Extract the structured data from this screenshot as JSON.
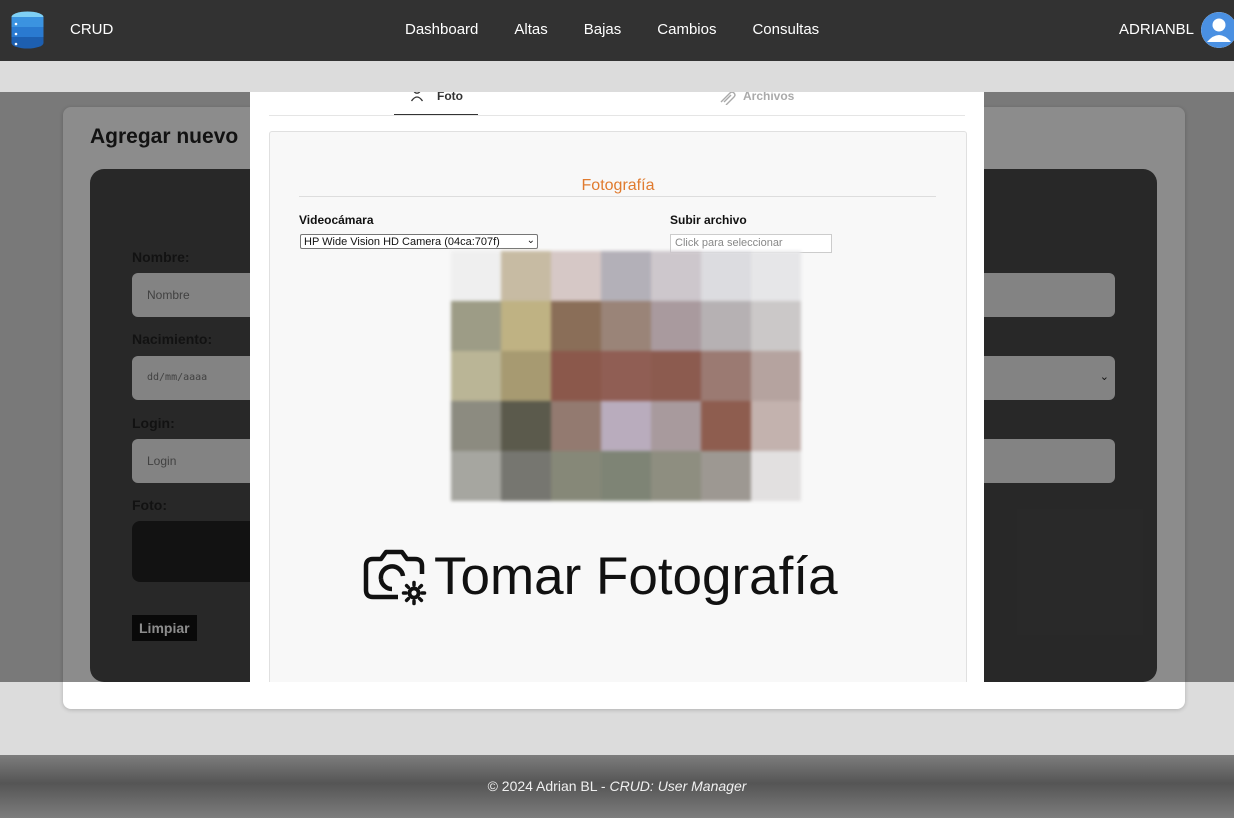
{
  "app": {
    "brand": "CRUD",
    "user": "ADRIANBL"
  },
  "nav": {
    "items": [
      "Dashboard",
      "Altas",
      "Bajas",
      "Cambios",
      "Consultas"
    ]
  },
  "page": {
    "title": "Agregar nuevo",
    "form": {
      "nombre_label": "Nombre:",
      "nombre_placeholder": "Nombre",
      "nacimiento_label": "Nacimiento:",
      "nacimiento_placeholder": "dd/mm/aaaa",
      "login_label": "Login:",
      "login_placeholder": "Login",
      "foto_label": "Foto:",
      "clear_button": "Limpiar"
    }
  },
  "modal": {
    "tabs": [
      {
        "label": "Foto",
        "active": true
      },
      {
        "label": "Archivos",
        "active": false
      }
    ],
    "section_title": "Fotografía",
    "camera_label": "Videocámara",
    "camera_value": "HP Wide Vision HD Camera (04ca:707f)",
    "upload_label": "Subir archivo",
    "upload_placeholder": "Click para seleccionar",
    "take_photo": "Tomar Fotografía"
  },
  "footer": {
    "copyright": "© 2024 Adrian BL - ",
    "app_name": "CRUD: User Manager"
  },
  "colors": {
    "nav_bg": "#323232",
    "accent": "#e07b2f",
    "avatar": "#4a90e2",
    "panel": "#4a4a4a"
  },
  "icons": [
    "database-icon",
    "user-avatar-icon",
    "user-icon",
    "paperclip-icon",
    "camera-settings-icon",
    "chevron-down-icon"
  ]
}
